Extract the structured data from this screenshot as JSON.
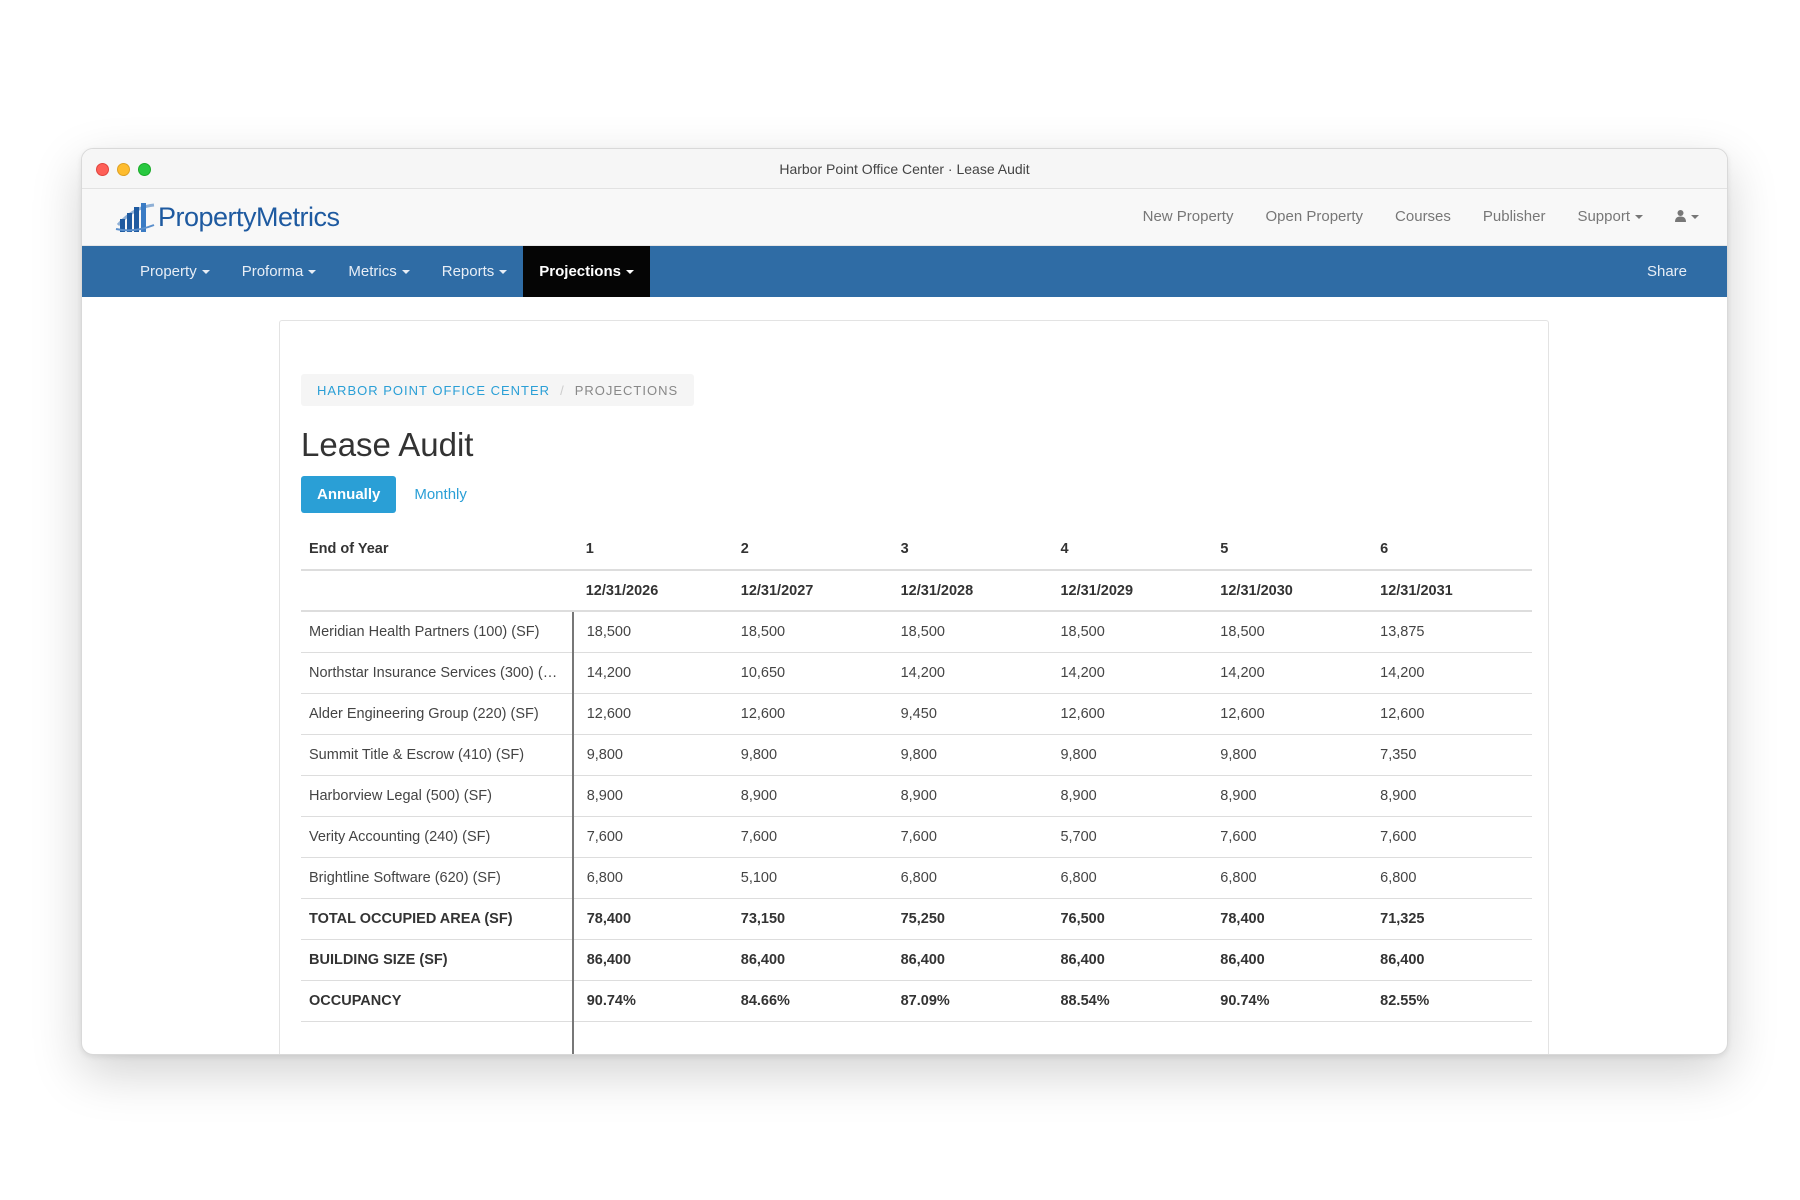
{
  "window": {
    "title": "Harbor Point Office Center · Lease Audit"
  },
  "brand": {
    "name_part1": "Property",
    "name_part2": "Metrics",
    "color": "#1e5aa0"
  },
  "topnav": {
    "links": [
      "New Property",
      "Open Property",
      "Courses",
      "Publisher"
    ],
    "support": "Support"
  },
  "mainnav": {
    "items": [
      "Property",
      "Proforma",
      "Metrics",
      "Reports"
    ],
    "active": "Projections",
    "share": "Share",
    "bg_color": "#2f6ca5"
  },
  "breadcrumb": {
    "parent": "HARBOR POINT OFFICE CENTER",
    "current": "PROJECTIONS"
  },
  "page": {
    "title": "Lease Audit",
    "period_selected": "Annually",
    "period_other": "Monthly"
  },
  "table": {
    "header_label": "End of Year",
    "years": [
      "1",
      "2",
      "3",
      "4",
      "5",
      "6"
    ],
    "dates": [
      "12/31/2026",
      "12/31/2027",
      "12/31/2028",
      "12/31/2029",
      "12/31/2030",
      "12/31/2031"
    ],
    "rows": [
      {
        "label": "Meridian Health Partners (100) (SF)",
        "values": [
          "18,500",
          "18,500",
          "18,500",
          "18,500",
          "18,500",
          "13,875"
        ]
      },
      {
        "label": "Northstar Insurance Services (300) (…",
        "values": [
          "14,200",
          "10,650",
          "14,200",
          "14,200",
          "14,200",
          "14,200"
        ]
      },
      {
        "label": "Alder Engineering Group (220) (SF)",
        "values": [
          "12,600",
          "12,600",
          "9,450",
          "12,600",
          "12,600",
          "12,600"
        ]
      },
      {
        "label": "Summit Title & Escrow (410) (SF)",
        "values": [
          "9,800",
          "9,800",
          "9,800",
          "9,800",
          "9,800",
          "7,350"
        ]
      },
      {
        "label": "Harborview Legal (500) (SF)",
        "values": [
          "8,900",
          "8,900",
          "8,900",
          "8,900",
          "8,900",
          "8,900"
        ]
      },
      {
        "label": "Verity Accounting (240) (SF)",
        "values": [
          "7,600",
          "7,600",
          "7,600",
          "5,700",
          "7,600",
          "7,600"
        ]
      },
      {
        "label": "Brightline Software (620) (SF)",
        "values": [
          "6,800",
          "5,100",
          "6,800",
          "6,800",
          "6,800",
          "6,800"
        ]
      }
    ],
    "totals": [
      {
        "label": "TOTAL OCCUPIED AREA (SF)",
        "values": [
          "78,400",
          "73,150",
          "75,250",
          "76,500",
          "78,400",
          "71,325"
        ]
      },
      {
        "label": "BUILDING SIZE (SF)",
        "values": [
          "86,400",
          "86,400",
          "86,400",
          "86,400",
          "86,400",
          "86,400"
        ]
      },
      {
        "label": "OCCUPANCY",
        "values": [
          "90.74%",
          "84.66%",
          "87.09%",
          "88.54%",
          "90.74%",
          "82.55%"
        ]
      }
    ]
  }
}
